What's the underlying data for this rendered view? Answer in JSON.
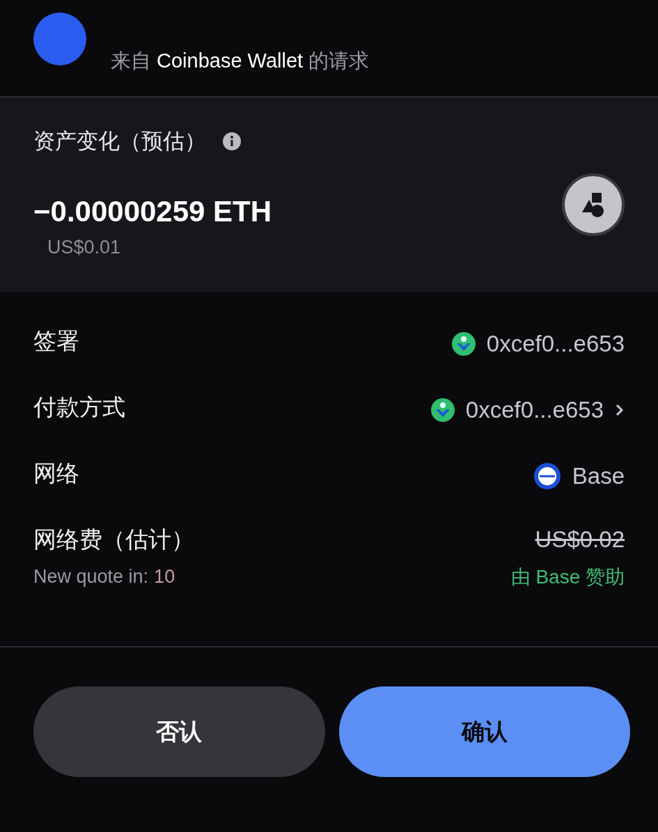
{
  "header": {
    "prefix": "来自",
    "app": "Coinbase Wallet",
    "suffix": "的请求"
  },
  "asset_change": {
    "title": "资产变化（预估）",
    "amount": "−0.00000259 ETH",
    "fiat": "US$0.01"
  },
  "rows": [
    {
      "kind": "account",
      "label": "签署",
      "value": "0xcef0...e653",
      "chevron": false
    },
    {
      "kind": "account",
      "label": "付款方式",
      "value": "0xcef0...e653",
      "chevron": true
    },
    {
      "kind": "network",
      "label": "网络",
      "value": "Base",
      "chevron": false
    },
    {
      "kind": "fee",
      "label": "网络费（估计）",
      "value": "US$0.02",
      "struck": true,
      "quote_label": "New quote in:",
      "countdown": "10",
      "sponsor": "由 Base 赞助"
    }
  ],
  "buttons": [
    {
      "label": "否认",
      "kind": "secondary"
    },
    {
      "label": "确认",
      "kind": "primary"
    }
  ]
}
